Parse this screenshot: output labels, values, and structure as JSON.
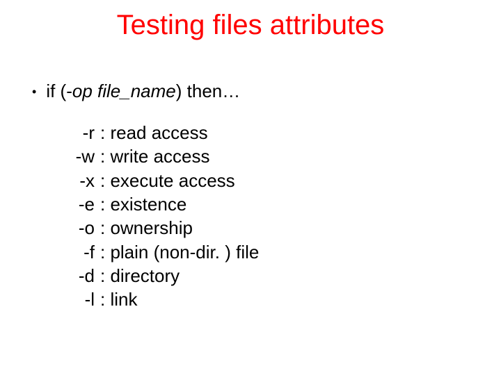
{
  "title": "Testing files attributes",
  "bullet": {
    "prefix": "if (-",
    "op": "op",
    "filename": " file_name",
    "suffix": ") then…"
  },
  "rows": [
    {
      "flag": "-r",
      "desc": ": read access"
    },
    {
      "flag": "-w",
      "desc": ": write access"
    },
    {
      "flag": "-x",
      "desc": ": execute access"
    },
    {
      "flag": "-e",
      "desc": ": existence"
    },
    {
      "flag": "-o",
      "desc": ": ownership"
    },
    {
      "flag": "-f",
      "desc": ": plain (non-dir. ) file"
    },
    {
      "flag": "-d",
      "desc": ": directory"
    },
    {
      "flag": "-l",
      "desc": ": link"
    }
  ]
}
